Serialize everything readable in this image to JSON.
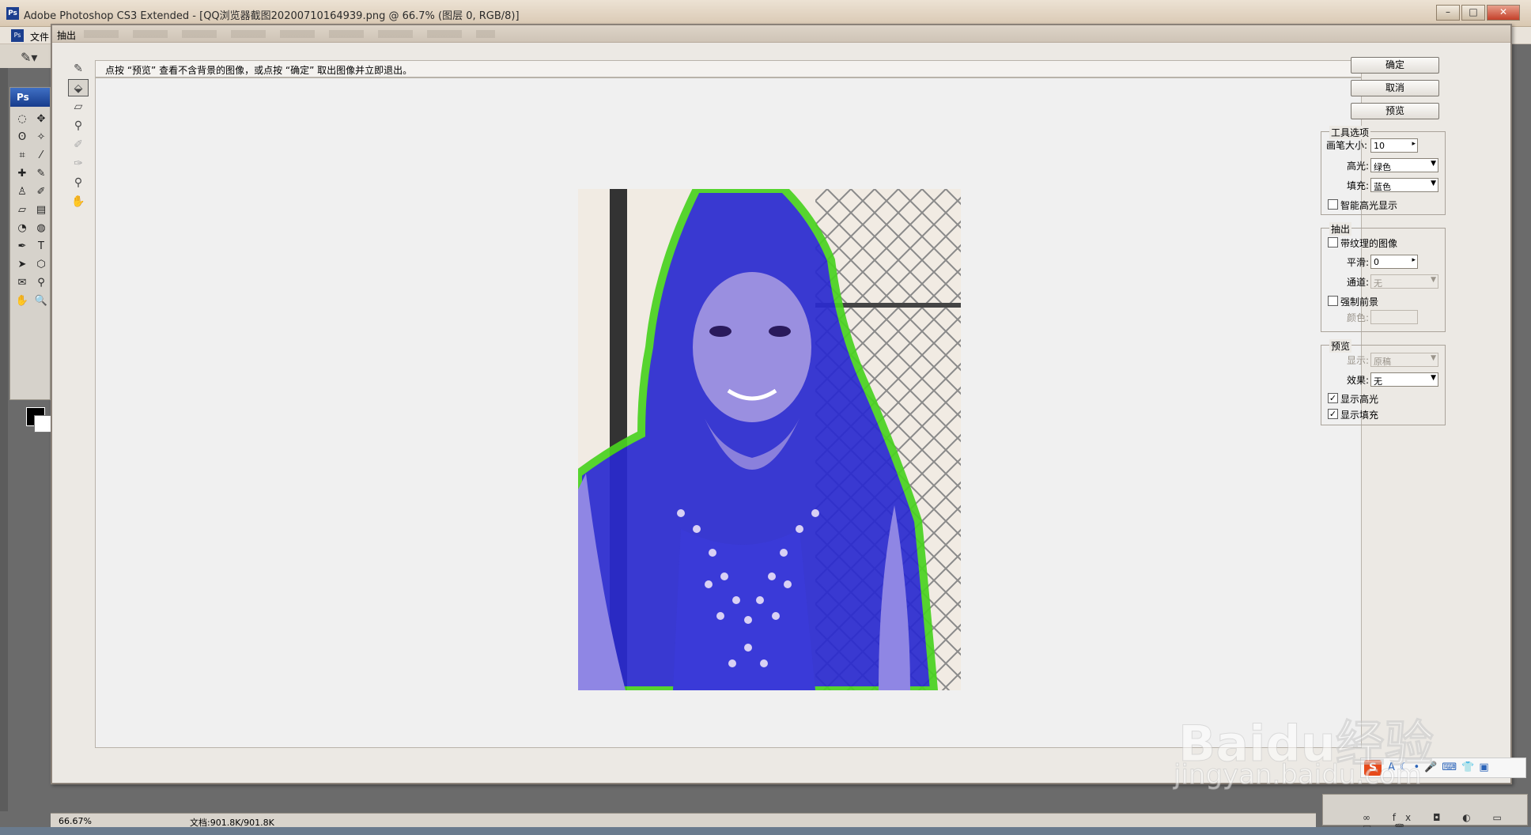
{
  "app": {
    "title": "Adobe Photoshop CS3 Extended - [QQ浏览器截图20200710164939.png @ 66.7% (图层 0, RGB/8)]",
    "ps_badge": "Ps",
    "menu_file": "文件"
  },
  "dialog": {
    "title": "抽出",
    "hint": "点按 “预览” 查看不含背景的图像，或点按 “确定” 取出图像并立即退出。",
    "tools": [
      "edge-highlighter",
      "fill",
      "eraser",
      "eyedropper",
      "cleanup",
      "edge-touchup",
      "zoom",
      "hand"
    ]
  },
  "buttons": {
    "ok": "确定",
    "cancel": "取消",
    "preview": "预览"
  },
  "tool_options": {
    "group_title": "工具选项",
    "brush_size_label": "画笔大小:",
    "brush_size_value": "10",
    "highlight_label": "高光:",
    "highlight_value": "绿色",
    "fill_label": "填充:",
    "fill_value": "蓝色",
    "smart_highlight_label": "智能高光显示",
    "smart_highlight_checked": false
  },
  "extraction": {
    "group_title": "抽出",
    "textured_label": "带纹理的图像",
    "textured_checked": false,
    "smooth_label": "平滑:",
    "smooth_value": "0",
    "channel_label": "通道:",
    "channel_value": "无",
    "force_fg_label": "强制前景",
    "force_fg_checked": false,
    "color_label": "颜色:"
  },
  "preview": {
    "group_title": "预览",
    "show_label": "显示:",
    "show_value": "原稿",
    "effect_label": "效果:",
    "effect_value": "无",
    "show_highlight_label": "显示高光",
    "show_highlight_checked": true,
    "show_fill_label": "显示填充",
    "show_fill_checked": true
  },
  "status": {
    "zoom": "66.67%",
    "doc": "文档:901.8K/901.8K"
  },
  "colors": {
    "highlight": "#49d320",
    "fill": "#2a2ad0",
    "dialog_bg": "#ece9e4"
  },
  "watermark": {
    "line1": "Baidu经验",
    "line2": "jingyan.baidu.com"
  }
}
